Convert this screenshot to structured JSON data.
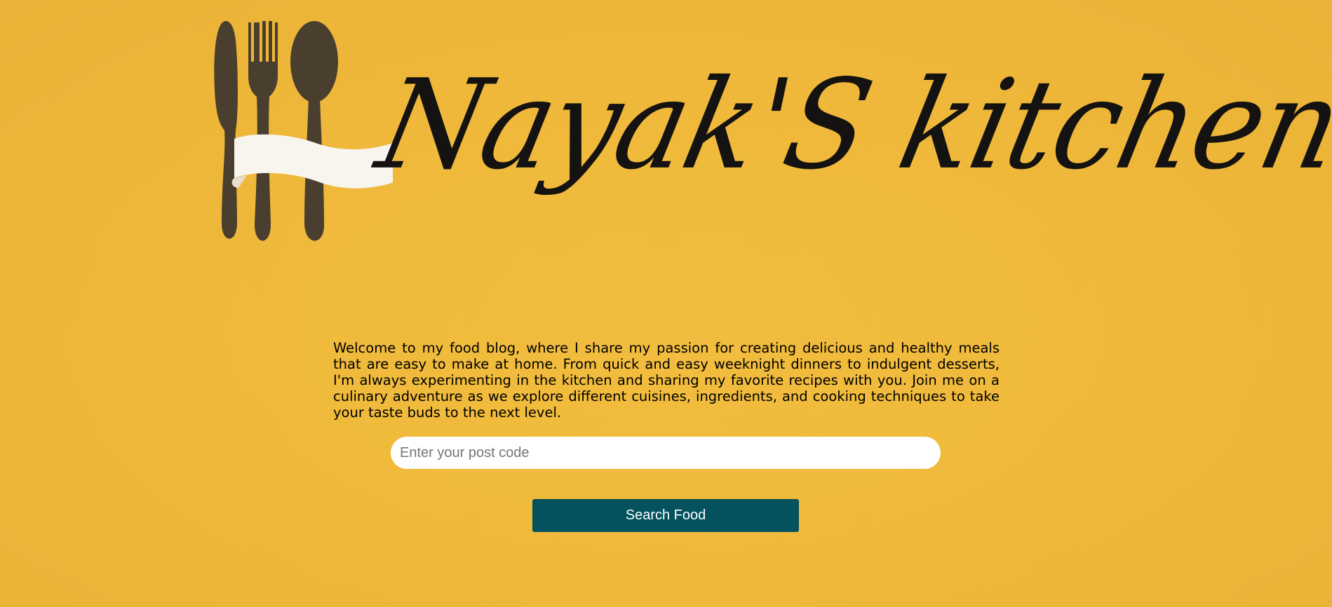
{
  "logo": {
    "brand_text": "Nayak'S kitchen",
    "icons": [
      "knife-icon",
      "fork-icon",
      "spoon-icon",
      "ribbon-banner"
    ],
    "colors": {
      "script": "#151311",
      "utensils": "#4a3f2e",
      "ribbon": "#f8f5ee"
    }
  },
  "intro": {
    "text": "Welcome to my food blog, where I share my passion for creating delicious and healthy meals that are easy to make at home. From quick and easy weeknight dinners to indulgent desserts, I'm always experimenting in the kitchen and sharing my favorite recipes with you. Join me on a culinary adventure as we explore different cuisines, ingredients, and cooking techniques to take your taste buds to the next level."
  },
  "search": {
    "placeholder": "Enter your post code",
    "value": "",
    "button_label": "Search Food"
  },
  "colors": {
    "background": "#efb83a",
    "button": "#03525d",
    "button_text": "#ffffff",
    "input_bg": "#ffffff"
  }
}
